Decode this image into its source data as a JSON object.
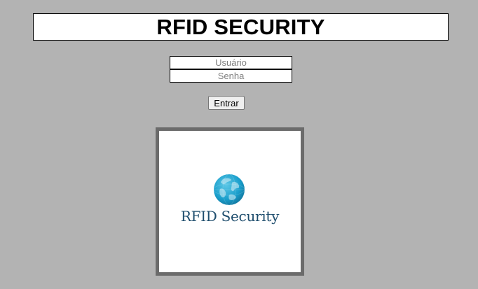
{
  "header": {
    "title": "RFID SECURITY"
  },
  "login": {
    "username_placeholder": "Usuário",
    "password_placeholder": "Senha",
    "submit_label": "Entrar"
  },
  "logo": {
    "icon": "globe-icon",
    "text": "RFID Security",
    "accent_color": "#1a9fcc",
    "text_color": "#1f4e6e"
  },
  "colors": {
    "page_background": "#b3b3b3",
    "frame_border": "#6b6b6b"
  }
}
